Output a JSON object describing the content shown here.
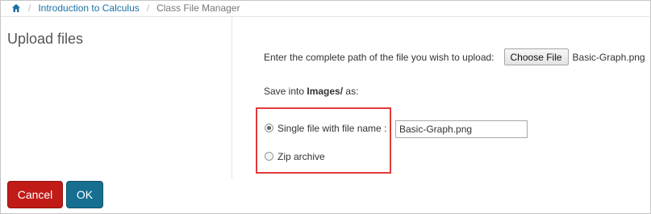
{
  "breadcrumb": {
    "home_icon": "home-icon",
    "items": [
      "Introduction to Calculus",
      "Class File Manager"
    ]
  },
  "sidebar": {
    "title": "Upload files"
  },
  "upload": {
    "prompt": "Enter the complete path of the file you wish to upload:",
    "choose_label": "Choose File",
    "chosen_file": "Basic-Graph.png"
  },
  "save": {
    "prefix": "Save into ",
    "folder": "Images/",
    "suffix": " as:"
  },
  "options": {
    "single_label": "Single file with file name :",
    "single_checked": true,
    "filename_value": "Basic-Graph.png",
    "zip_label": "Zip archive",
    "zip_checked": false
  },
  "actions": {
    "cancel": "Cancel",
    "ok": "OK"
  },
  "colors": {
    "highlight": "#e23a3a",
    "cancel": "#c11b17",
    "ok": "#166f91",
    "link": "#1a70a3"
  }
}
